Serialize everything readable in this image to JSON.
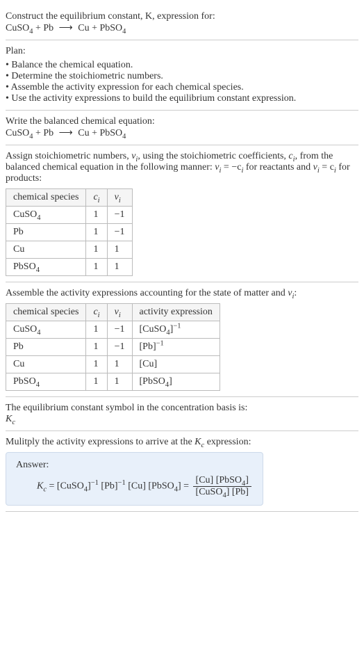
{
  "intro": {
    "line1": "Construct the equilibrium constant, K, expression for:",
    "equation_lhs": "CuSO",
    "equation_sub1": "4",
    "equation_plus1": " + Pb ",
    "equation_arrow": "⟶",
    "equation_rhs": " Cu + PbSO",
    "equation_sub2": "4"
  },
  "plan": {
    "title": "Plan:",
    "b1": "Balance the chemical equation.",
    "b2": "Determine the stoichiometric numbers.",
    "b3": "Assemble the activity expression for each chemical species.",
    "b4": "Use the activity expressions to build the equilibrium constant expression."
  },
  "balanced": {
    "title": "Write the balanced chemical equation:",
    "lhs": "CuSO",
    "sub1": "4",
    "plus": " + Pb ",
    "arrow": "⟶",
    "rhs": " Cu + PbSO",
    "sub2": "4"
  },
  "assign": {
    "p1a": "Assign stoichiometric numbers, ",
    "nu": "ν",
    "i": "i",
    "p1b": ", using the stoichiometric coefficients, ",
    "c": "c",
    "p1c": ", from the balanced chemical equation in the following manner: ",
    "eq1a": "ν",
    "eq1b": " = −c",
    "eq1c": " for reactants and ",
    "eq2a": "ν",
    "eq2b": " = c",
    "eq2c": " for products:"
  },
  "table1": {
    "h1": "chemical species",
    "h2": "c",
    "h2sub": "i",
    "h3": "ν",
    "h3sub": "i",
    "rows": [
      {
        "sp_a": "CuSO",
        "sp_sub": "4",
        "c": "1",
        "v": "−1"
      },
      {
        "sp_a": "Pb",
        "sp_sub": "",
        "c": "1",
        "v": "−1"
      },
      {
        "sp_a": "Cu",
        "sp_sub": "",
        "c": "1",
        "v": "1"
      },
      {
        "sp_a": "PbSO",
        "sp_sub": "4",
        "c": "1",
        "v": "1"
      }
    ]
  },
  "assemble": {
    "p1": "Assemble the activity expressions accounting for the state of matter and ",
    "nu": "ν",
    "i": "i",
    "p2": ":"
  },
  "table2": {
    "h1": "chemical species",
    "h2": "c",
    "h2sub": "i",
    "h3": "ν",
    "h3sub": "i",
    "h4": "activity expression",
    "rows": [
      {
        "sp_a": "CuSO",
        "sp_sub": "4",
        "c": "1",
        "v": "−1",
        "act_a": "[CuSO",
        "act_sub": "4",
        "act_b": "]",
        "act_sup": "−1"
      },
      {
        "sp_a": "Pb",
        "sp_sub": "",
        "c": "1",
        "v": "−1",
        "act_a": "[Pb]",
        "act_sub": "",
        "act_b": "",
        "act_sup": "−1"
      },
      {
        "sp_a": "Cu",
        "sp_sub": "",
        "c": "1",
        "v": "1",
        "act_a": "[Cu]",
        "act_sub": "",
        "act_b": "",
        "act_sup": ""
      },
      {
        "sp_a": "PbSO",
        "sp_sub": "4",
        "c": "1",
        "v": "1",
        "act_a": "[PbSO",
        "act_sub": "4",
        "act_b": "]",
        "act_sup": ""
      }
    ]
  },
  "symbol": {
    "p": "The equilibrium constant symbol in the concentration basis is:",
    "k": "K",
    "ksub": "c"
  },
  "multiply": {
    "p1": "Mulitply the activity expressions to arrive at the ",
    "k": "K",
    "ksub": "c",
    "p2": " expression:"
  },
  "answer": {
    "label": "Answer:",
    "k": "K",
    "ksub": "c",
    "eq": " = [CuSO",
    "sub1": "4",
    "exp1": "−1",
    "mid1": " [Pb]",
    "exp2": "−1",
    "mid2": " [Cu] [PbSO",
    "sub2": "4",
    "mid3": "] = ",
    "num": "[Cu] [PbSO",
    "numsub": "4",
    "numend": "]",
    "den": "[CuSO",
    "densub": "4",
    "denend": "] [Pb]"
  }
}
